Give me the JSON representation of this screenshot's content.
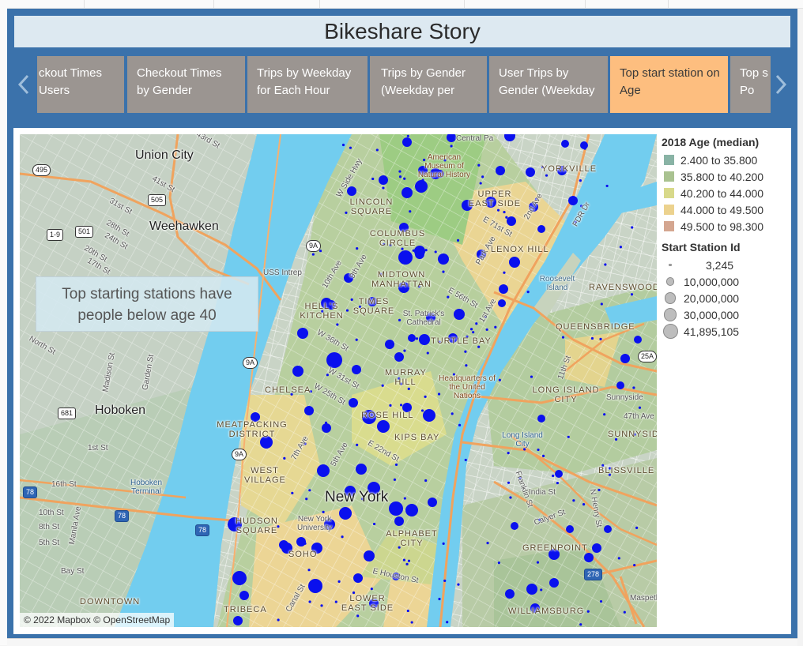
{
  "story": {
    "title": "Bikeshare Story",
    "tabs": [
      {
        "label": "ckout Times Users"
      },
      {
        "label": "Checkout Times by Gender"
      },
      {
        "label": "Trips by Weekday for Each Hour"
      },
      {
        "label": "Trips by Gender (Weekday per"
      },
      {
        "label": "User Trips by Gender (Weekday"
      },
      {
        "label": "Top start station on Age",
        "active": true
      },
      {
        "label": "Top s on Po"
      }
    ],
    "prev_icon": "chevron-left-icon",
    "next_icon": "chevron-right-icon"
  },
  "map": {
    "annotation": {
      "line1": "Top starting stations have",
      "line2": "people below age 40"
    },
    "attribution": "© 2022 Mapbox © OpenStreetMap",
    "labels": {
      "union_city": "Union City",
      "weehawken": "Weehawken",
      "hoboken": "Hoboken",
      "new_york": "New York",
      "hoboken_terminal": "Hoboken Terminal",
      "central_park": "Central Pa",
      "museum": "American Museum of Natural History",
      "yorkville": "YORKVILLE",
      "upper_east_side": "UPPER EAST SIDE",
      "lincoln_square": "LINCOLN SQUARE",
      "columbus_circle": "COLUMBUS CIRCLE",
      "lenox_hill": "LENOX HILL",
      "roosevelt_island": "Roosevelt Island",
      "ravenswood": "RAVENSWOOD",
      "midtown": "MIDTOWN MANHATTAN",
      "hells_kitchen": "HELL'S KITCHEN",
      "times_square": "TIMES SQUARE",
      "st_patricks": "St. Patrick's Cathedral",
      "turtle_bay": "TURTLE BAY",
      "queensbridge": "QUEENSBRIDGE",
      "uss_intrepid": "USS Intrep",
      "murray_hill": "MURRAY HILL",
      "un_hq": "Headquarters of the United Nations",
      "long_island_city": "LONG ISLAND CITY",
      "chelsea": "CHELSEA",
      "meatpacking": "MEATPACKING DISTRICT",
      "rose_hill": "ROSE HILL",
      "kips_bay": "KIPS BAY",
      "long_island_city_small": "Long Island City",
      "sunnyside": "SUNNYSIDE",
      "blissville": "BLISSVILLE",
      "west_village": "WEST VILLAGE",
      "hudson_square": "HUDSON SQUARE",
      "nyu": "New York University",
      "alphabet_city": "ALPHABET CITY",
      "soho": "SOHO",
      "greenpoint": "GREENPOINT",
      "tribeca": "TRIBECA",
      "lower_east_side": "LOWER EAST SIDE",
      "williamsburg": "WILLIAMSBURG",
      "downtown": "DOWNTOWN",
      "sunnyside_yards": "Sunnyside"
    },
    "streets": [
      "W 31st St",
      "31st St",
      "28th St",
      "24th St",
      "20th St",
      "17th St",
      "41st St",
      "43rd St",
      "42nd St",
      "North St",
      "Madison St",
      "Garden St",
      "1st St",
      "16th St",
      "10th St",
      "8th St",
      "5th St",
      "Bay St",
      "Manila Ave",
      "W Side Hwy",
      "10th Ave",
      "9th Ave",
      "W 36th St",
      "W 31st St",
      "W 25th St",
      "7th Ave",
      "5th Ave",
      "E 22nd St",
      "E 56th St",
      "1st Ave",
      "2nd Ave",
      "Park Ave",
      "E 71st St",
      "FDR Dr",
      "Canal St",
      "E Houston St",
      "11th St",
      "47th Ave",
      "Franklin St",
      "India St",
      "Calyer St",
      "N Henry St",
      "Maspeth"
    ],
    "shields": [
      "495",
      "505",
      "1-9",
      "501",
      "681",
      "9A",
      "78",
      "278",
      "25A"
    ]
  },
  "legend": {
    "color_title": "2018 Age (median)",
    "color_items": [
      {
        "label": "2.400 to 35.800",
        "color": "#89b3a5"
      },
      {
        "label": "35.800 to 40.200",
        "color": "#a9c290"
      },
      {
        "label": "40.200 to 44.000",
        "color": "#d8d98a"
      },
      {
        "label": "44.000 to 49.500",
        "color": "#ecd28e"
      },
      {
        "label": "49.500 to 98.300",
        "color": "#d4a690"
      }
    ],
    "size_title": "Start Station Id",
    "size_items": [
      {
        "label": "3,245",
        "value": 3245
      },
      {
        "label": "10,000,000",
        "value": 10000000
      },
      {
        "label": "20,000,000",
        "value": 20000000
      },
      {
        "label": "30,000,000",
        "value": 30000000
      },
      {
        "label": "41,895,105",
        "value": 41895105
      }
    ]
  }
}
